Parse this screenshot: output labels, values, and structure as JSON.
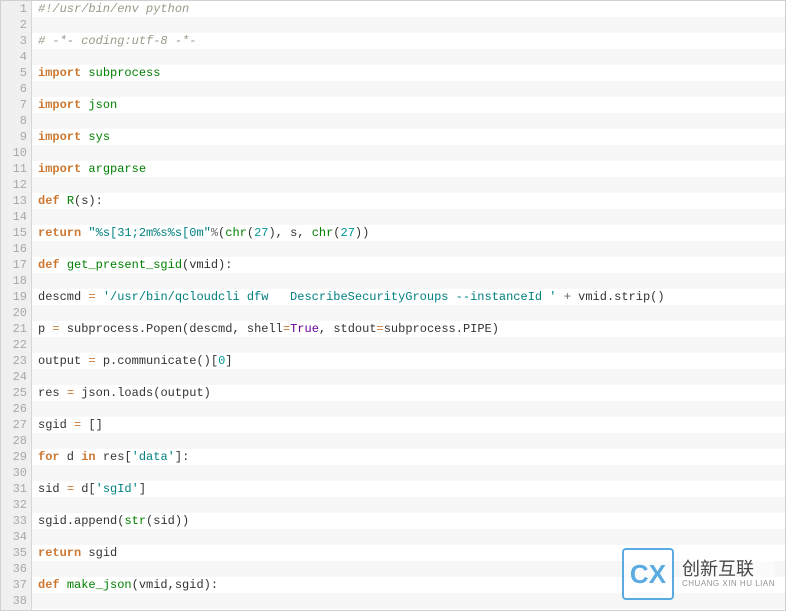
{
  "watermark": {
    "logo_text": "CX",
    "brand_cn": "创新互联",
    "brand_en": "CHUANG XIN HU LIAN"
  },
  "code": {
    "lines": [
      {
        "n": 1,
        "tokens": [
          [
            "#!/usr/bin/env python",
            "comment"
          ]
        ]
      },
      {
        "n": 2,
        "tokens": []
      },
      {
        "n": 3,
        "tokens": [
          [
            "# -*- coding:utf-8 -*-",
            "comment"
          ]
        ]
      },
      {
        "n": 4,
        "tokens": []
      },
      {
        "n": 5,
        "tokens": [
          [
            "import",
            "keyword"
          ],
          [
            " ",
            "name"
          ],
          [
            "subprocess",
            "def"
          ]
        ]
      },
      {
        "n": 6,
        "tokens": []
      },
      {
        "n": 7,
        "tokens": [
          [
            "import",
            "keyword"
          ],
          [
            " ",
            "name"
          ],
          [
            "json",
            "def"
          ]
        ]
      },
      {
        "n": 8,
        "tokens": []
      },
      {
        "n": 9,
        "tokens": [
          [
            "import",
            "keyword"
          ],
          [
            " ",
            "name"
          ],
          [
            "sys",
            "def"
          ]
        ]
      },
      {
        "n": 10,
        "tokens": []
      },
      {
        "n": 11,
        "tokens": [
          [
            "import",
            "keyword"
          ],
          [
            " ",
            "name"
          ],
          [
            "argparse",
            "def"
          ]
        ]
      },
      {
        "n": 12,
        "tokens": []
      },
      {
        "n": 13,
        "tokens": [
          [
            "def",
            "keyword"
          ],
          [
            " ",
            "name"
          ],
          [
            "R",
            "def"
          ],
          [
            "(",
            "punct"
          ],
          [
            "s",
            "name"
          ],
          [
            ")",
            "punct"
          ],
          [
            ":",
            "punct"
          ]
        ]
      },
      {
        "n": 14,
        "tokens": []
      },
      {
        "n": 15,
        "tokens": [
          [
            "return",
            "keyword"
          ],
          [
            " ",
            "name"
          ],
          [
            "\"%s[31;2m%s%s[0m\"",
            "string"
          ],
          [
            "%",
            "op"
          ],
          [
            "(",
            "punct"
          ],
          [
            "chr",
            "builtin"
          ],
          [
            "(",
            "punct"
          ],
          [
            "27",
            "number"
          ],
          [
            ")",
            "punct"
          ],
          [
            ", ",
            "punct"
          ],
          [
            "s",
            "name"
          ],
          [
            ", ",
            "punct"
          ],
          [
            "chr",
            "builtin"
          ],
          [
            "(",
            "punct"
          ],
          [
            "27",
            "number"
          ],
          [
            "))",
            "punct"
          ]
        ]
      },
      {
        "n": 16,
        "tokens": []
      },
      {
        "n": 17,
        "tokens": [
          [
            "def",
            "keyword"
          ],
          [
            " ",
            "name"
          ],
          [
            "get_present_sgid",
            "def"
          ],
          [
            "(",
            "punct"
          ],
          [
            "vmid",
            "name"
          ],
          [
            ")",
            "punct"
          ],
          [
            ":",
            "punct"
          ]
        ]
      },
      {
        "n": 18,
        "tokens": []
      },
      {
        "n": 19,
        "tokens": [
          [
            "descmd ",
            "name"
          ],
          [
            "=",
            "assign"
          ],
          [
            " ",
            "name"
          ],
          [
            "'/usr/bin/qcloudcli dfw   DescribeSecurityGroups --instanceId '",
            "string"
          ],
          [
            " ",
            "name"
          ],
          [
            "+",
            "op"
          ],
          [
            " vmid",
            "name"
          ],
          [
            ".",
            "punct"
          ],
          [
            "strip",
            "name"
          ],
          [
            "()",
            "punct"
          ]
        ]
      },
      {
        "n": 20,
        "tokens": []
      },
      {
        "n": 21,
        "tokens": [
          [
            "p ",
            "name"
          ],
          [
            "=",
            "assign"
          ],
          [
            " subprocess",
            "name"
          ],
          [
            ".",
            "punct"
          ],
          [
            "Popen",
            "name"
          ],
          [
            "(",
            "punct"
          ],
          [
            "descmd",
            "name"
          ],
          [
            ", ",
            "punct"
          ],
          [
            "shell",
            "name"
          ],
          [
            "=",
            "assign"
          ],
          [
            "True",
            "const"
          ],
          [
            ", ",
            "punct"
          ],
          [
            "stdout",
            "name"
          ],
          [
            "=",
            "assign"
          ],
          [
            "subprocess",
            "name"
          ],
          [
            ".",
            "punct"
          ],
          [
            "PIPE",
            "name"
          ],
          [
            ")",
            "punct"
          ]
        ]
      },
      {
        "n": 22,
        "tokens": []
      },
      {
        "n": 23,
        "tokens": [
          [
            "output ",
            "name"
          ],
          [
            "=",
            "assign"
          ],
          [
            " p",
            "name"
          ],
          [
            ".",
            "punct"
          ],
          [
            "communicate",
            "name"
          ],
          [
            "()",
            "punct"
          ],
          [
            "[",
            "punct"
          ],
          [
            "0",
            "number"
          ],
          [
            "]",
            "punct"
          ]
        ]
      },
      {
        "n": 24,
        "tokens": []
      },
      {
        "n": 25,
        "tokens": [
          [
            "res ",
            "name"
          ],
          [
            "=",
            "assign"
          ],
          [
            " json",
            "name"
          ],
          [
            ".",
            "punct"
          ],
          [
            "loads",
            "name"
          ],
          [
            "(",
            "punct"
          ],
          [
            "output",
            "name"
          ],
          [
            ")",
            "punct"
          ]
        ]
      },
      {
        "n": 26,
        "tokens": []
      },
      {
        "n": 27,
        "tokens": [
          [
            "sgid ",
            "name"
          ],
          [
            "=",
            "assign"
          ],
          [
            " ",
            "name"
          ],
          [
            "[]",
            "punct"
          ]
        ]
      },
      {
        "n": 28,
        "tokens": []
      },
      {
        "n": 29,
        "tokens": [
          [
            "for",
            "keyword"
          ],
          [
            " d ",
            "name"
          ],
          [
            "in",
            "keyword"
          ],
          [
            " res",
            "name"
          ],
          [
            "[",
            "punct"
          ],
          [
            "'data'",
            "string"
          ],
          [
            "]",
            "punct"
          ],
          [
            ":",
            "punct"
          ]
        ]
      },
      {
        "n": 30,
        "tokens": []
      },
      {
        "n": 31,
        "tokens": [
          [
            "sid ",
            "name"
          ],
          [
            "=",
            "assign"
          ],
          [
            " d",
            "name"
          ],
          [
            "[",
            "punct"
          ],
          [
            "'sgId'",
            "string"
          ],
          [
            "]",
            "punct"
          ]
        ]
      },
      {
        "n": 32,
        "tokens": []
      },
      {
        "n": 33,
        "tokens": [
          [
            "sgid",
            "name"
          ],
          [
            ".",
            "punct"
          ],
          [
            "append",
            "name"
          ],
          [
            "(",
            "punct"
          ],
          [
            "str",
            "builtin"
          ],
          [
            "(",
            "punct"
          ],
          [
            "sid",
            "name"
          ],
          [
            "))",
            "punct"
          ]
        ]
      },
      {
        "n": 34,
        "tokens": []
      },
      {
        "n": 35,
        "tokens": [
          [
            "return",
            "keyword"
          ],
          [
            " sgid",
            "name"
          ]
        ]
      },
      {
        "n": 36,
        "tokens": []
      },
      {
        "n": 37,
        "tokens": [
          [
            "def",
            "keyword"
          ],
          [
            " ",
            "name"
          ],
          [
            "make_json",
            "def"
          ],
          [
            "(",
            "punct"
          ],
          [
            "vmid",
            "name"
          ],
          [
            ",",
            "punct"
          ],
          [
            "sgid",
            "name"
          ],
          [
            ")",
            "punct"
          ],
          [
            ":",
            "punct"
          ]
        ]
      },
      {
        "n": 38,
        "tokens": []
      }
    ]
  }
}
